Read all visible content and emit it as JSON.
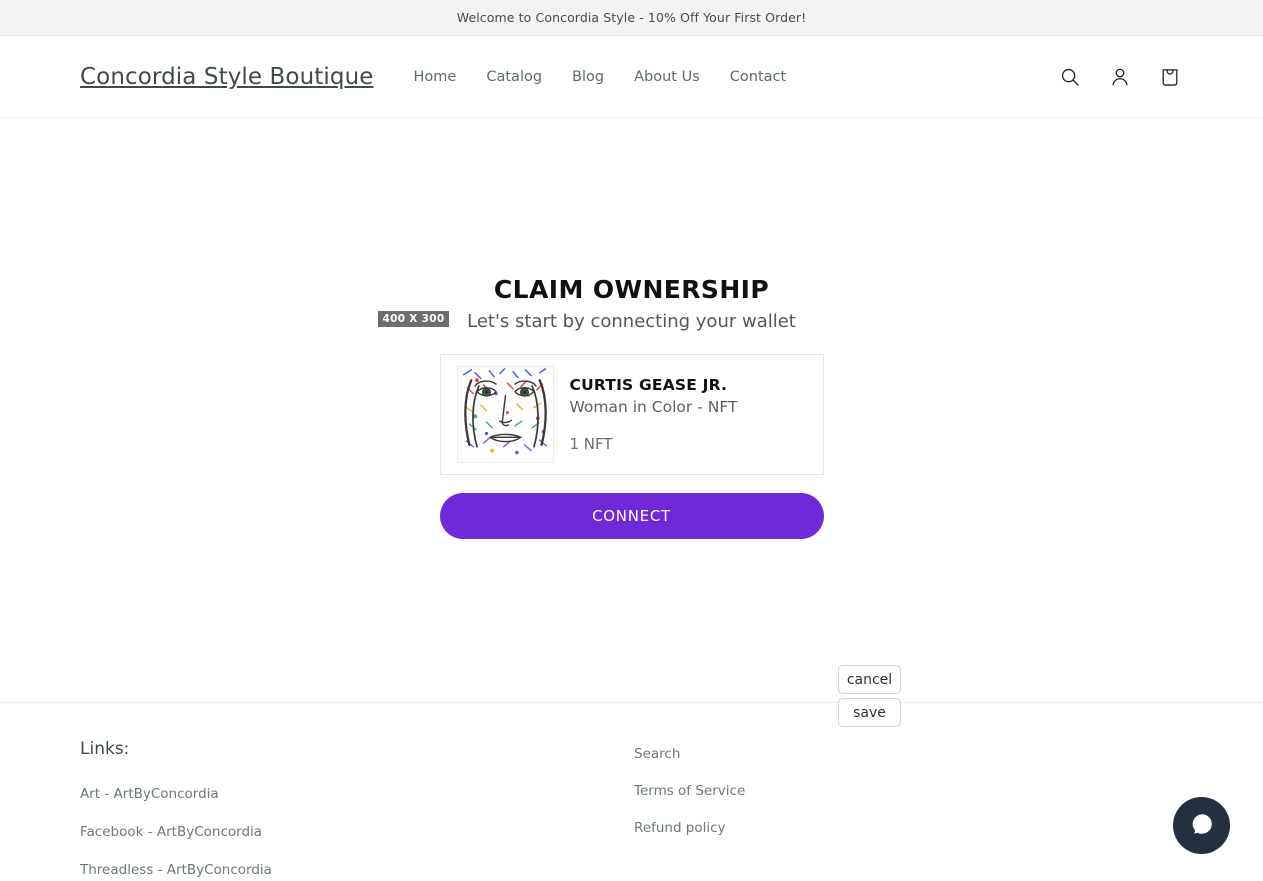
{
  "announcement": {
    "text": "Welcome to Concordia Style - 10% Off Your First Order!"
  },
  "header": {
    "brand": "Concordia Style Boutique",
    "nav": [
      {
        "label": "Home"
      },
      {
        "label": "Catalog"
      },
      {
        "label": "Blog"
      },
      {
        "label": "About Us"
      },
      {
        "label": "Contact"
      }
    ],
    "icons": [
      {
        "name": "search-icon"
      },
      {
        "name": "account-icon"
      },
      {
        "name": "cart-icon"
      }
    ]
  },
  "back_button": {
    "icon": "arrow-left-icon"
  },
  "claim": {
    "title": "CLAIM OWNERSHIP",
    "subtitle": "Let's start by connecting your wallet",
    "size_badge": "400 X 300",
    "nft": {
      "artist": "CURTIS GEASE JR.",
      "description": "Woman in Color - NFT",
      "count": "1 NFT",
      "thumbnail_alt": "woman-in-color-nft-artwork"
    },
    "connect_label": "CONNECT"
  },
  "edit_actions": {
    "cancel_label": "cancel",
    "save_label": "save"
  },
  "footer": {
    "heading": "Links:",
    "column_one": [
      {
        "label": "Art - ArtByConcordia"
      },
      {
        "label": "Facebook - ArtByConcordia"
      },
      {
        "label": "Threadless - ArtByConcordia"
      }
    ],
    "column_two": [
      {
        "label": "Search"
      },
      {
        "label": "Terms of Service"
      },
      {
        "label": "Refund policy"
      }
    ]
  },
  "chat": {
    "icon": "chat-bubble-icon"
  },
  "colors": {
    "accent_purple": "#7028d8",
    "announcement_bg": "#f3f3f3",
    "brand_text": "#3f4a49",
    "badge_bg": "#6d6d6d",
    "chat_bg": "#25303f"
  }
}
